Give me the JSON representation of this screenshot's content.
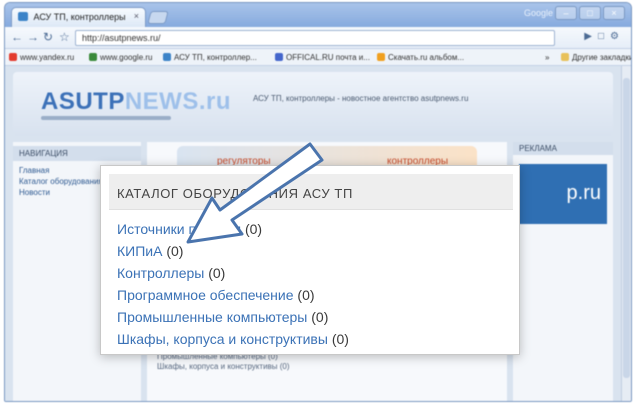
{
  "browser": {
    "tab_title": "АСУ ТП, контроллеры",
    "tab_close": "×",
    "window_user": "Google",
    "window_buttons": [
      "–",
      "□",
      "×"
    ],
    "address": "http://asutpnews.ru/",
    "bookmarks": [
      {
        "label": "www.yandex.ru",
        "color": "#e33b2e"
      },
      {
        "label": "www.google.ru",
        "color": "#3a8a3a"
      },
      {
        "label": "АСУ ТП, контроллер...",
        "color": "#3b83c8"
      },
      {
        "label": "OFFICAL.RU почта и...",
        "color": "#4466cc"
      },
      {
        "label": "Скачать.ru альбом...",
        "color": "#f0a020"
      }
    ],
    "bookmarks_more": "»",
    "bookmarks_other": "Другие закладки"
  },
  "site": {
    "logo_main": "ASUTP",
    "logo_alt": "NEWS.ru",
    "header_text": "АСУ ТП, контроллеры - новостное агентство asutpnews.ru",
    "left_header": "НАВИГАЦИЯ",
    "left_items": [
      "Главная",
      "Каталог оборудования",
      "Новости"
    ],
    "banner_left": "регуляторы",
    "banner_right": "контроллеры",
    "right_header": "РЕКЛАМА",
    "ad_text": "p.ru",
    "center_lines": [
      "Промышленные компьютеры (0)",
      "Шкафы, корпуса и конструктивы (0)"
    ]
  },
  "popup": {
    "title": "КАТАЛОГ ОБОРУДОВАНИЯ АСУ ТП",
    "items": [
      {
        "label": "Источники питания",
        "count": "(0)"
      },
      {
        "label": "КИПиА",
        "count": "(0)"
      },
      {
        "label": "Контроллеры",
        "count": "(0)"
      },
      {
        "label": "Программное обеспечение",
        "count": "(0)"
      },
      {
        "label": "Промышленные компьютеры",
        "count": "(0)"
      },
      {
        "label": "Шкафы, корпуса и конструктивы",
        "count": "(0)"
      }
    ]
  },
  "colors": {
    "link": "#3b72b6",
    "arrow_stroke": "#4a74ad",
    "arrow_fill": "#ffffff"
  }
}
